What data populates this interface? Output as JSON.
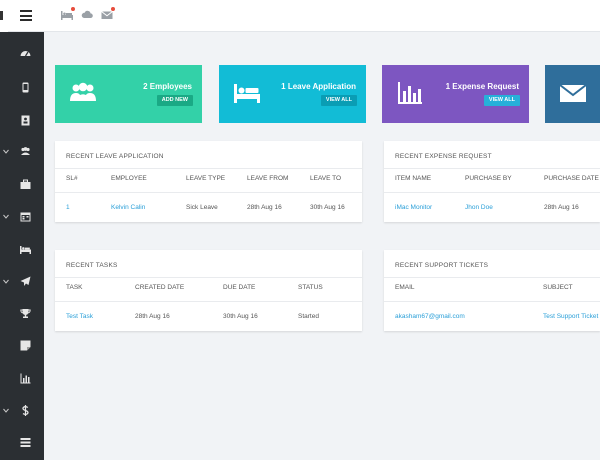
{
  "topbar": {
    "icons": [
      {
        "name": "bed-icon"
      },
      {
        "name": "cloud-icon"
      },
      {
        "name": "envelope-icon"
      }
    ]
  },
  "sidebar": {
    "items": [
      {
        "icon": "dashboard-icon",
        "expandable": false
      },
      {
        "icon": "phone-icon",
        "expandable": false
      },
      {
        "icon": "id-card-icon",
        "expandable": false
      },
      {
        "icon": "users-icon",
        "expandable": true
      },
      {
        "icon": "briefcase-icon",
        "expandable": false
      },
      {
        "icon": "calendar-icon",
        "expandable": true
      },
      {
        "icon": "bed-icon",
        "expandable": false
      },
      {
        "icon": "plane-icon",
        "expandable": true
      },
      {
        "icon": "trophy-icon",
        "expandable": false
      },
      {
        "icon": "note-icon",
        "expandable": false
      },
      {
        "icon": "chart-icon",
        "expandable": false
      },
      {
        "icon": "dollar-icon",
        "expandable": true
      },
      {
        "icon": "list-icon",
        "expandable": false
      }
    ]
  },
  "stats": [
    {
      "title": "2 Employees",
      "button": "ADD NEW",
      "color": "#33d1a8",
      "btn_color": "#1aa985",
      "icon": "users-icon"
    },
    {
      "title": "1 Leave Application",
      "button": "VIEW ALL",
      "color": "#12bcd6",
      "btn_color": "#0a9db4",
      "icon": "bed-icon"
    },
    {
      "title": "1 Expense Request",
      "button": "VIEW ALL",
      "color": "#7d56c1",
      "btn_color": "#26b0d9",
      "icon": "chart-icon"
    },
    {
      "title": "",
      "button": "",
      "color": "#2f6e9b",
      "btn_color": "#2f6e9b",
      "icon": "envelope-icon"
    }
  ],
  "leave_panel": {
    "title": "RECENT LEAVE APPLICATION",
    "headers": [
      "SL#",
      "EMPLOYEE",
      "LEAVE TYPE",
      "LEAVE FROM",
      "LEAVE TO"
    ],
    "rows": [
      [
        "1",
        "Kelvin Calin",
        "Sick Leave",
        "28th Aug 16",
        "30th Aug 16"
      ]
    ]
  },
  "expense_panel": {
    "title": "RECENT EXPENSE REQUEST",
    "headers": [
      "ITEM NAME",
      "PURCHASE BY",
      "PURCHASE DATE"
    ],
    "rows": [
      [
        "iMac Monitor",
        "Jhon Doe",
        "28th Aug 16"
      ]
    ]
  },
  "tasks_panel": {
    "title": "RECENT TASKS",
    "headers": [
      "TASK",
      "CREATED DATE",
      "DUE DATE",
      "STATUS"
    ],
    "rows": [
      [
        "Test Task",
        "28th Aug 16",
        "30th Aug 16",
        "Started"
      ]
    ]
  },
  "tickets_panel": {
    "title": "RECENT SUPPORT TICKETS",
    "headers": [
      "EMAIL",
      "SUBJECT"
    ],
    "rows": [
      [
        "akasham67@gmail.com",
        "Test Support Ticket"
      ]
    ]
  }
}
